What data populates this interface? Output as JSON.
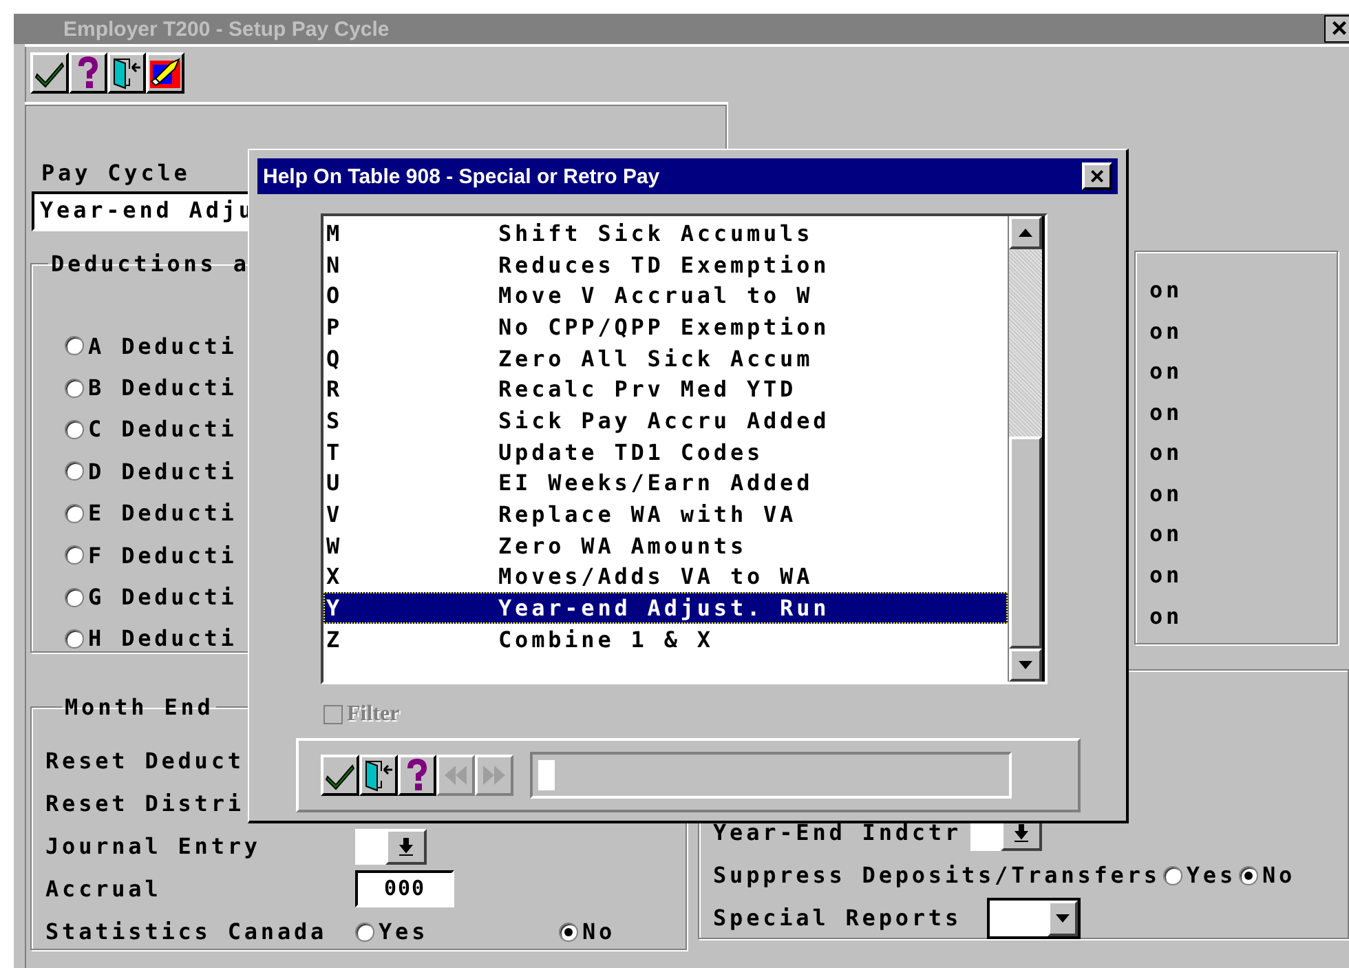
{
  "window": {
    "title": "Employer T200 - Setup Pay Cycle",
    "close": "×"
  },
  "toolbar": [
    {
      "kind": "ok"
    },
    {
      "kind": "help"
    },
    {
      "kind": "exit"
    },
    {
      "kind": "clear"
    }
  ],
  "pay_cycle": {
    "label": "Pay Cycle",
    "value": "Year-end Adju"
  },
  "deductions": {
    "legend": "Deductions a",
    "options": [
      {
        "label": "A Deducti",
        "selected": false
      },
      {
        "label": "B Deducti",
        "selected": false
      },
      {
        "label": "C Deducti",
        "selected": false
      },
      {
        "label": "D Deducti",
        "selected": false
      },
      {
        "label": "E Deducti",
        "selected": false
      },
      {
        "label": "F Deducti",
        "selected": false
      },
      {
        "label": "G Deducti",
        "selected": false
      },
      {
        "label": "H Deducti",
        "selected": false
      }
    ],
    "column_2": [
      "on",
      "on",
      "on",
      "on",
      "on",
      "on",
      "on",
      "on",
      "on"
    ]
  },
  "month_end": {
    "legend": "Month End",
    "rows": [
      {
        "kind": "text",
        "label": "Reset Deduct"
      },
      {
        "kind": "text",
        "label": "Reset Distri"
      },
      {
        "kind": "dropdown",
        "label": "Journal Entry"
      },
      {
        "kind": "input",
        "label": "Accrual",
        "value": "000"
      },
      {
        "kind": "radio",
        "label": "Statistics Canada",
        "options": [
          {
            "label": "Yes",
            "selected": false
          },
          {
            "label": "No",
            "selected": true
          }
        ]
      }
    ]
  },
  "year_end": {
    "rows": [
      {
        "kind": "dropdown",
        "label": "Year-End Indctr"
      },
      {
        "kind": "radio",
        "label": "Suppress Deposits/Transfers",
        "options": [
          {
            "label": "Yes",
            "selected": false
          },
          {
            "label": "No",
            "selected": true
          }
        ]
      },
      {
        "kind": "combo",
        "label": "Special Reports"
      }
    ]
  },
  "dialog": {
    "title": "Help On Table 908 - Special or Retro Pay",
    "close": "×",
    "items": [
      {
        "code": "M",
        "description": "Shift Sick Accumuls",
        "selected": false
      },
      {
        "code": "N",
        "description": "Reduces TD Exemption",
        "selected": false
      },
      {
        "code": "O",
        "description": "Move V Accrual to W",
        "selected": false
      },
      {
        "code": "P",
        "description": "No CPP/QPP Exemption",
        "selected": false
      },
      {
        "code": "Q",
        "description": "Zero All Sick Accum",
        "selected": false
      },
      {
        "code": "R",
        "description": "Recalc Prv Med YTD",
        "selected": false
      },
      {
        "code": "S",
        "description": "Sick Pay Accru Added",
        "selected": false
      },
      {
        "code": "T",
        "description": "Update TD1 Codes",
        "selected": false
      },
      {
        "code": "U",
        "description": "EI Weeks/Earn Added",
        "selected": false
      },
      {
        "code": "V",
        "description": "Replace WA with VA",
        "selected": false
      },
      {
        "code": "W",
        "description": "Zero WA Amounts",
        "selected": false
      },
      {
        "code": "X",
        "description": "Moves/Adds VA to WA",
        "selected": false
      },
      {
        "code": "Y",
        "description": "Year-end Adjust. Run",
        "selected": true
      },
      {
        "code": "Z",
        "description": "Combine 1 & X",
        "selected": false
      }
    ],
    "filter": {
      "label": "Filter",
      "checked": false,
      "disabled": true
    },
    "buttons": [
      {
        "kind": "ok",
        "disabled": false
      },
      {
        "kind": "exit",
        "disabled": false
      },
      {
        "kind": "help",
        "disabled": false
      },
      {
        "kind": "prev",
        "disabled": true
      },
      {
        "kind": "next",
        "disabled": true
      }
    ]
  }
}
